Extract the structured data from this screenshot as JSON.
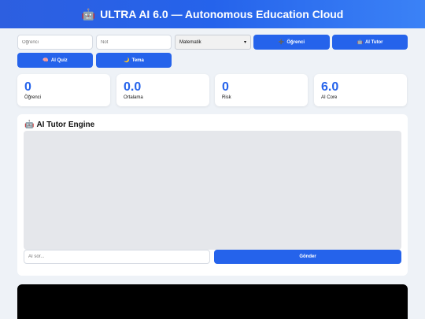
{
  "header": {
    "logo_icon": "robot-icon",
    "title": "ULTRA AI 6.0 — Autonomous Education Cloud"
  },
  "form": {
    "student_placeholder": "Öğrenci",
    "grade_placeholder": "Not",
    "subject_selected": "Matematik",
    "add_student_label": "Öğrenci",
    "ai_tutor_label": "AI Tutor",
    "ai_quiz_label": "AI Quiz",
    "theme_label": "Tema"
  },
  "stats": [
    {
      "value": "0",
      "label": "Öğrenci"
    },
    {
      "value": "0.0",
      "label": "Ortalama"
    },
    {
      "value": "0",
      "label": "Risk"
    },
    {
      "value": "6.0",
      "label": "AI Core"
    }
  ],
  "tutor": {
    "title": "AI Tutor Engine",
    "ask_placeholder": "AI sor...",
    "send_label": "Gönder"
  },
  "colors": {
    "accent": "#2563eb",
    "background": "#eef2f7"
  }
}
